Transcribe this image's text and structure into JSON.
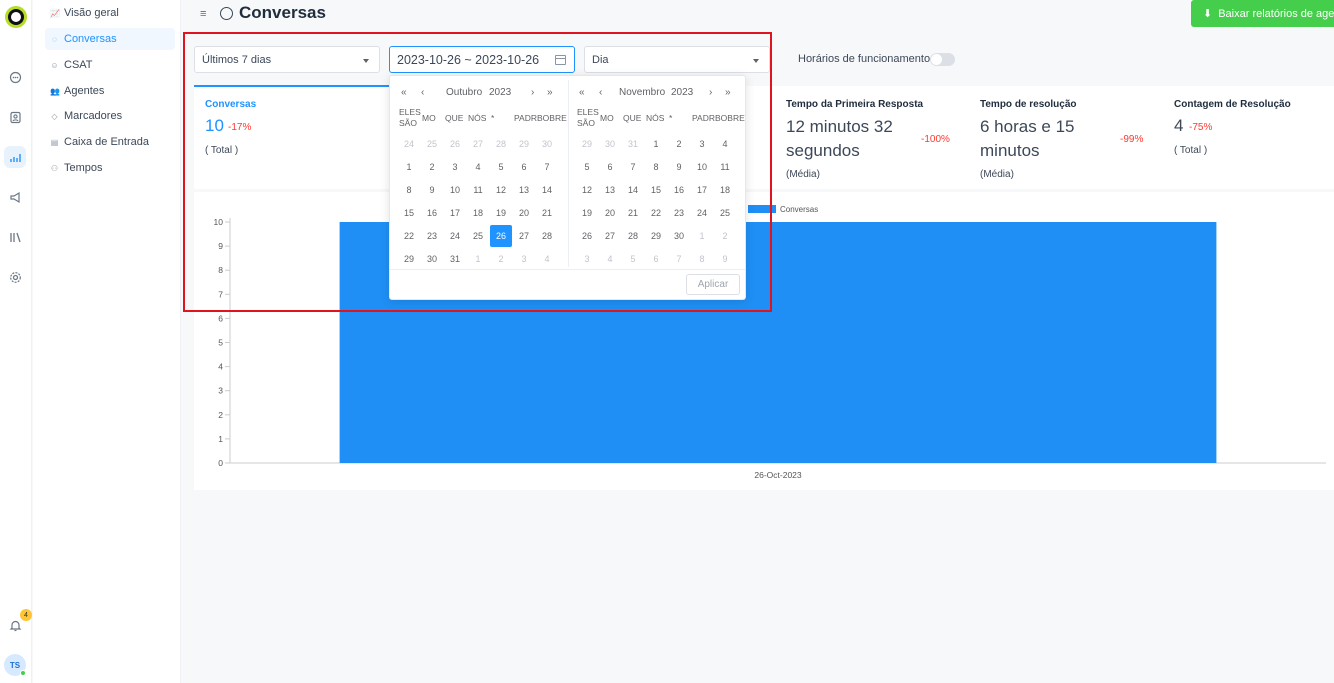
{
  "rail": {
    "notification_count": "4",
    "avatar_initials": "TS"
  },
  "sidebar": {
    "items": [
      {
        "label": "Visão geral",
        "icon": "chart-icon"
      },
      {
        "label": "Conversas",
        "icon": "chat-icon"
      },
      {
        "label": "CSAT",
        "icon": "smile-icon"
      },
      {
        "label": "Agentes",
        "icon": "users-icon"
      },
      {
        "label": "Marcadores",
        "icon": "tag-icon"
      },
      {
        "label": "Caixa de Entrada",
        "icon": "inbox-icon"
      },
      {
        "label": "Tempos",
        "icon": "team-icon"
      }
    ]
  },
  "header": {
    "title": "Conversas",
    "download_label": "Baixar relatórios de agentes"
  },
  "filters": {
    "range": "Últimos 7 dias",
    "date_range": "2023-10-26 ~ 2023-10-26",
    "group_by": "Dia",
    "business_hours_label": "Horários de funcionamento"
  },
  "metrics": [
    {
      "title": "Conversas",
      "value": "10",
      "delta": "-17%",
      "sub": "( Total )"
    },
    {
      "title": "Tempo da Primeira Resposta",
      "value_line1": "12 minutos 32",
      "value_line2": "segundos",
      "delta": "-100%",
      "sub": "(Média)"
    },
    {
      "title": "Tempo de resolução",
      "value_line1": "6 horas e 15",
      "value_line2": "minutos",
      "delta": "-99%",
      "sub": "(Média)"
    },
    {
      "title": "Contagem de Resolução",
      "value": "4",
      "delta": "-75%",
      "sub": "( Total )"
    }
  ],
  "chart_data": {
    "type": "bar",
    "categories": [
      "26-Oct-2023"
    ],
    "series": [
      {
        "name": "Conversas",
        "values": [
          10
        ]
      }
    ],
    "ylim": [
      0,
      10
    ],
    "yticks": [
      0,
      1,
      2,
      3,
      4,
      5,
      6,
      7,
      8,
      9,
      10
    ],
    "legend_position": "top-center",
    "color": "#1f8ff5"
  },
  "picker": {
    "left": {
      "month": "Outubro",
      "year": "2023",
      "weekdays": [
        "ELES SÃO",
        "MO",
        "QUE",
        "NÓS",
        "*",
        "PADR",
        "BOBRE"
      ],
      "weeks": [
        [
          "24",
          "25",
          "26",
          "27",
          "28",
          "29",
          "30"
        ],
        [
          "1",
          "2",
          "3",
          "4",
          "5",
          "6",
          "7"
        ],
        [
          "8",
          "9",
          "10",
          "11",
          "12",
          "13",
          "14"
        ],
        [
          "15",
          "16",
          "17",
          "18",
          "19",
          "20",
          "21"
        ],
        [
          "22",
          "23",
          "24",
          "25",
          "26",
          "27",
          "28"
        ],
        [
          "29",
          "30",
          "31",
          "1",
          "2",
          "3",
          "4"
        ]
      ]
    },
    "right": {
      "month": "Novembro",
      "year": "2023",
      "weekdays": [
        "ELES SÃO",
        "MO",
        "QUE",
        "NÓS",
        "*",
        "PADR",
        "BOBRE"
      ],
      "weeks": [
        [
          "29",
          "30",
          "31",
          "1",
          "2",
          "3",
          "4"
        ],
        [
          "5",
          "6",
          "7",
          "8",
          "9",
          "10",
          "11"
        ],
        [
          "12",
          "13",
          "14",
          "15",
          "16",
          "17",
          "18"
        ],
        [
          "19",
          "20",
          "21",
          "22",
          "23",
          "24",
          "25"
        ],
        [
          "26",
          "27",
          "28",
          "29",
          "30",
          "1",
          "2"
        ],
        [
          "3",
          "4",
          "5",
          "6",
          "7",
          "8",
          "9"
        ]
      ]
    },
    "selected_day": "26",
    "apply_label": "Aplicar",
    "nav": {
      "prev_year": "«",
      "prev_month": "‹",
      "next_month": "›",
      "next_year": "»"
    }
  }
}
